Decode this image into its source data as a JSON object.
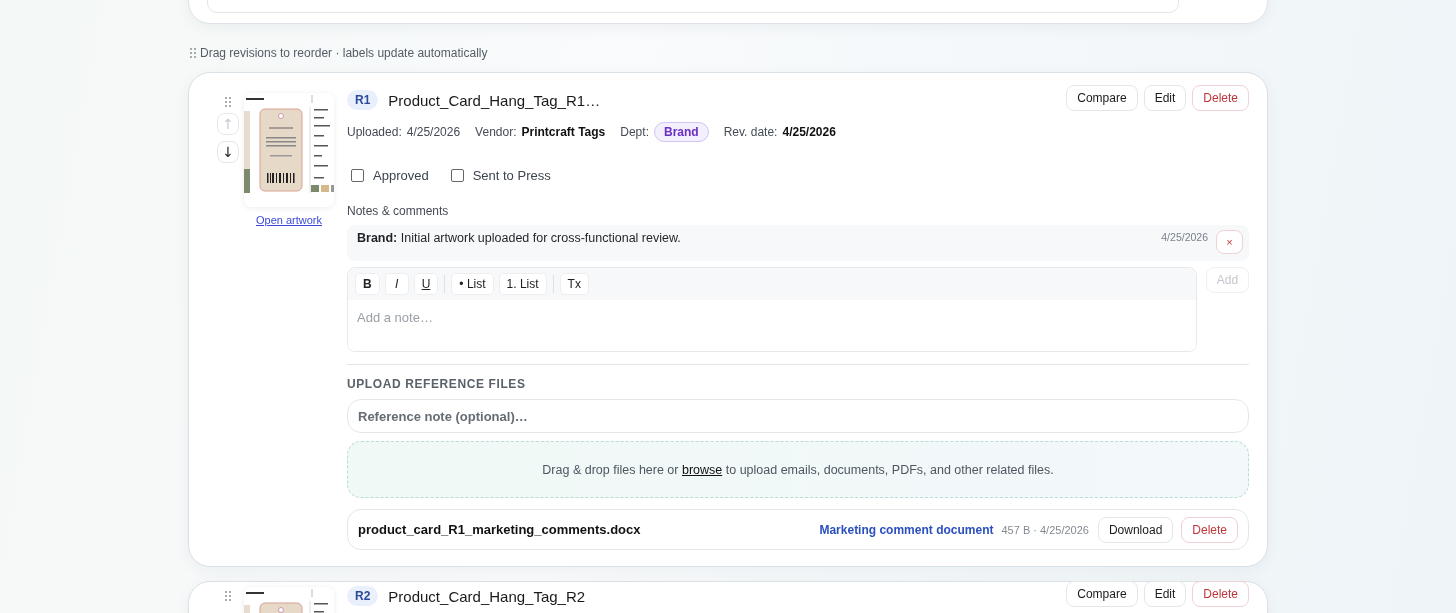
{
  "hint": "Drag revisions to reorder · labels update automatically",
  "revisions": [
    {
      "badge": "R1",
      "title": "Product_Card_Hang_Tag_R1…",
      "actions": [
        {
          "label": "Compare",
          "kind": "default"
        },
        {
          "label": "Edit",
          "kind": "default"
        },
        {
          "label": "Delete",
          "kind": "danger"
        }
      ],
      "move": [
        {
          "label": "↑",
          "disabled": true
        },
        {
          "label": "↓",
          "disabled": false
        }
      ],
      "artwork_link": "Open artwork",
      "meta": [
        {
          "label": "Uploaded:",
          "value": "4/25/2026",
          "kind": "plain"
        },
        {
          "label": "Vendor:",
          "value": "Printcraft Tags",
          "kind": "strong"
        },
        {
          "label": "Dept:",
          "value": "Brand",
          "kind": "pill"
        },
        {
          "label": "Rev. date:",
          "value": "4/25/2026",
          "kind": "strong"
        }
      ],
      "checkboxes": [
        {
          "label": "Approved",
          "checked": false
        },
        {
          "label": "Sent to Press",
          "checked": false
        }
      ],
      "notes_label": "Notes & comments",
      "notes": [
        {
          "text": "**Brand:** Initial artwork uploaded for cross-functional review.",
          "date": "4/25/2026",
          "remove": "×"
        }
      ],
      "toolbar": [
        [
          {
            "label": "B",
            "kind": "bold"
          },
          {
            "label": "I",
            "kind": "italic"
          },
          {
            "label": "U",
            "kind": "underline"
          }
        ],
        [
          {
            "label": "• List",
            "kind": "bullet"
          },
          {
            "label": "1. List",
            "kind": "numbered"
          }
        ],
        [
          {
            "label": "Tx",
            "kind": "clear"
          }
        ]
      ],
      "note_placeholder": "Add a note…",
      "add_button": {
        "label": "Add",
        "disabled": true
      },
      "upload": {
        "heading": "UPLOAD REFERENCE FILES",
        "note_placeholder": "Reference note (optional)…",
        "dropzone": {
          "before": "Drag & drop files here or ",
          "link": "browse",
          "after": " to upload emails, documents, PDFs, and other related files."
        },
        "files": [
          {
            "name": "product_card_R1_marketing_comments.docx",
            "description": "Marketing comment document",
            "meta": "457 B · 4/25/2026",
            "actions": [
              {
                "label": "Download",
                "kind": "default"
              },
              {
                "label": "Delete",
                "kind": "danger"
              }
            ]
          }
        ]
      }
    },
    {
      "badge": "R2",
      "title": "Product_Card_Hang_Tag_R2",
      "actions": [
        {
          "label": "Compare",
          "kind": "default"
        },
        {
          "label": "Edit",
          "kind": "default"
        },
        {
          "label": "Delete",
          "kind": "danger"
        }
      ]
    }
  ]
}
